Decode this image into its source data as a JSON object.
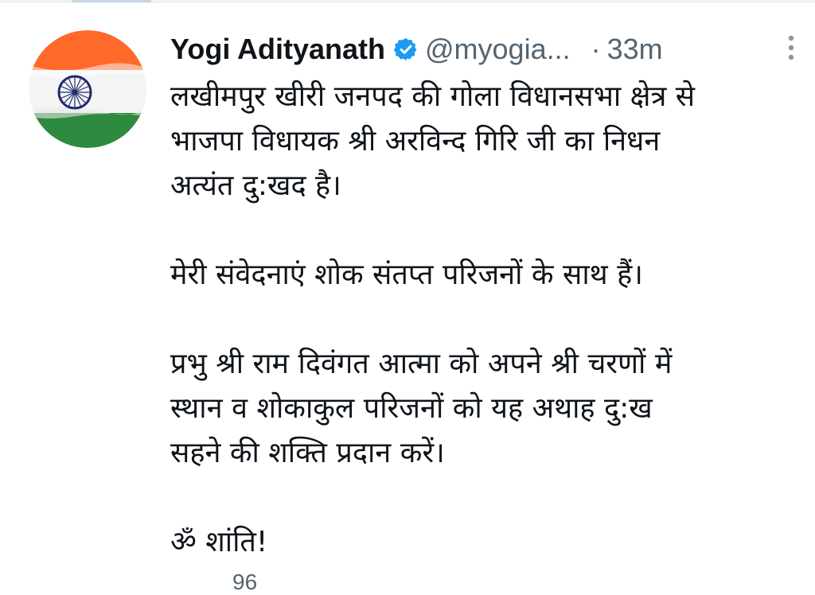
{
  "tweet": {
    "author": {
      "name": "Yogi Adityanath",
      "handle": "@myogia...",
      "verified": true
    },
    "separator": "·",
    "time": "33m",
    "paragraphs": [
      [
        "लखीमपुर खीरी जनपद की गोला विधानसभा क्षेत्र से",
        "भाजपा विधायक श्री अरविन्द गिरि जी का निधन",
        "अत्यंत दु:खद है।"
      ],
      [
        "मेरी संवेदनाएं शोक संतप्त परिजनों के साथ हैं।"
      ],
      [
        "प्रभु श्री राम दिवंगत आत्मा को अपने श्री चरणों में",
        "स्थान व शोकाकुल परिजनों को यह अथाह दु:ख",
        "सहने की शक्ति प्रदान करें।"
      ],
      [
        "ॐ शांति!"
      ]
    ],
    "metric_count": "96"
  },
  "colors": {
    "text": "#0f1419",
    "muted": "#536471",
    "verified_blue": "#1d9bf0",
    "flag_saffron": "#ff6a2b",
    "flag_white": "#f4f4f4",
    "flag_green": "#2e8a3e",
    "chakra_navy": "#1f2a6b"
  },
  "icons": {
    "avatar": "indian-flag-avatar",
    "verified": "verified-badge-icon",
    "more": "more-vertical-icon"
  }
}
